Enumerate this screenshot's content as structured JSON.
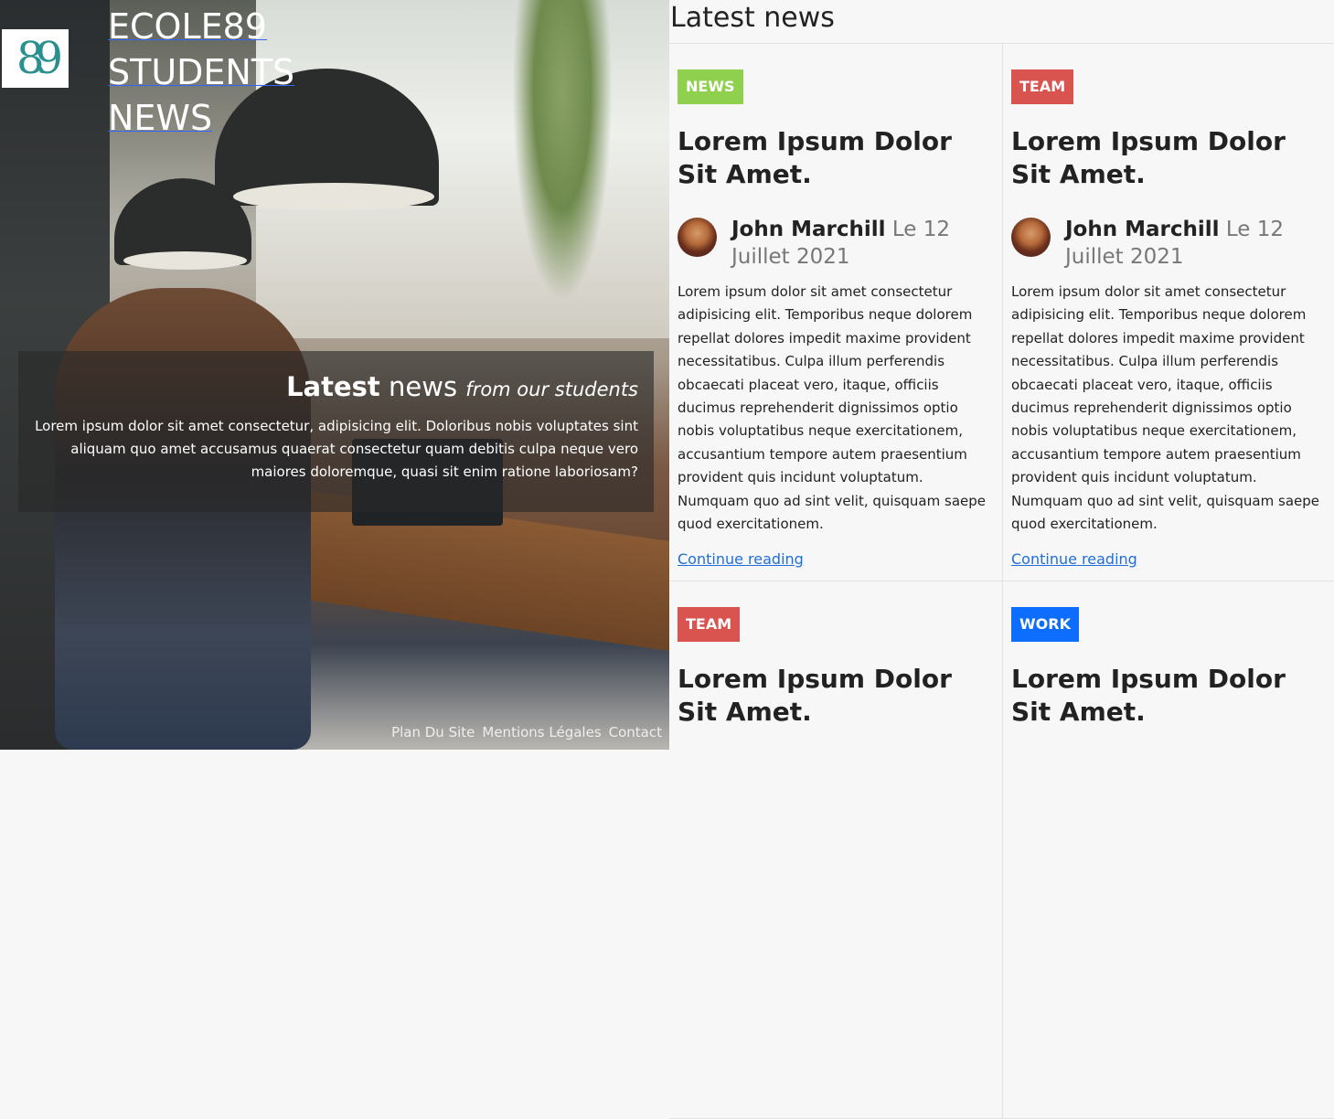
{
  "brand": {
    "logo_text": "89",
    "title_lines": [
      "ECOLE89",
      "STUDENTS",
      "NEWS"
    ]
  },
  "hero": {
    "heading_bold": "Latest",
    "heading_rest": "news",
    "heading_em": "from our students",
    "description": "Lorem ipsum dolor sit amet consectetur, adipisicing elit. Doloribus nobis voluptates sint aliquam quo amet accusamus quaerat consectetur quam debitis culpa neque vero maiores doloremque, quasi sit enim ratione laboriosam?"
  },
  "footer": {
    "links": [
      "Plan Du Site",
      "Mentions Légales",
      "Contact"
    ]
  },
  "main": {
    "title": "Latest news",
    "cards": [
      {
        "badge": "NEWS",
        "badge_color": "#8fd14f",
        "title": "Lorem Ipsum Dolor Sit Amet.",
        "author": "John Marchill",
        "date": "Le 12 Juillet 2021",
        "body": "Lorem ipsum dolor sit amet consectetur adipisicing elit. Temporibus neque dolorem repellat dolores impedit maxime provident necessitatibus. Culpa illum perferendis obcaecati placeat vero, itaque, officiis ducimus reprehenderit dignissimos optio nobis voluptatibus neque exercitationem, accusantium tempore autem praesentium provident quis incidunt voluptatum. Numquam quo ad sint velit, quisquam saepe quod exercitationem.",
        "link": "Continue reading"
      },
      {
        "badge": "TEAM",
        "badge_color": "#d9534f",
        "title": "Lorem Ipsum Dolor Sit Amet.",
        "author": "John Marchill",
        "date": "Le 12 Juillet 2021",
        "body": "Lorem ipsum dolor sit amet consectetur adipisicing elit. Temporibus neque dolorem repellat dolores impedit maxime provident necessitatibus. Culpa illum perferendis obcaecati placeat vero, itaque, officiis ducimus reprehenderit dignissimos optio nobis voluptatibus neque exercitationem, accusantium tempore autem praesentium provident quis incidunt voluptatum. Numquam quo ad sint velit, quisquam saepe quod exercitationem.",
        "link": "Continue reading"
      },
      {
        "badge": "TEAM",
        "badge_color": "#d9534f",
        "title": "Lorem Ipsum Dolor Sit Amet."
      },
      {
        "badge": "WORK",
        "badge_color": "#0d6efd",
        "title": "Lorem Ipsum Dolor Sit Amet."
      }
    ]
  }
}
